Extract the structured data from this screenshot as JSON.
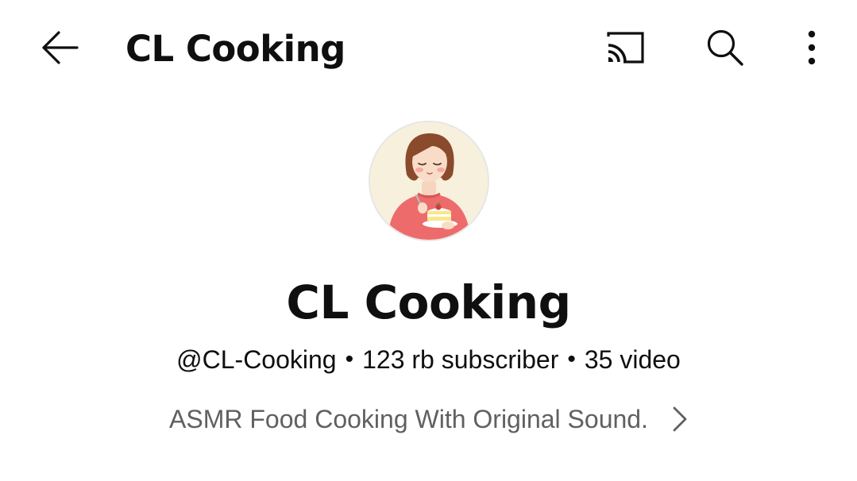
{
  "header": {
    "title": "CL Cooking",
    "icons": {
      "back": "arrow-back-icon",
      "cast": "cast-icon",
      "search": "search-icon",
      "more": "more-vert-icon"
    }
  },
  "channel": {
    "name": "CL Cooking",
    "handle": "@CL-Cooking",
    "separator": "•",
    "subscribers": "123 rb subscriber",
    "videos": "35 video",
    "description": "ASMR Food Cooking With Original Sound.",
    "avatar_icon": "avatar-illustration-woman-with-cake"
  },
  "colors": {
    "text_primary": "#0f0f0f",
    "text_secondary": "#606060",
    "avatar_bg": "#f6f0dc",
    "sweater": "#ee6b6b"
  }
}
